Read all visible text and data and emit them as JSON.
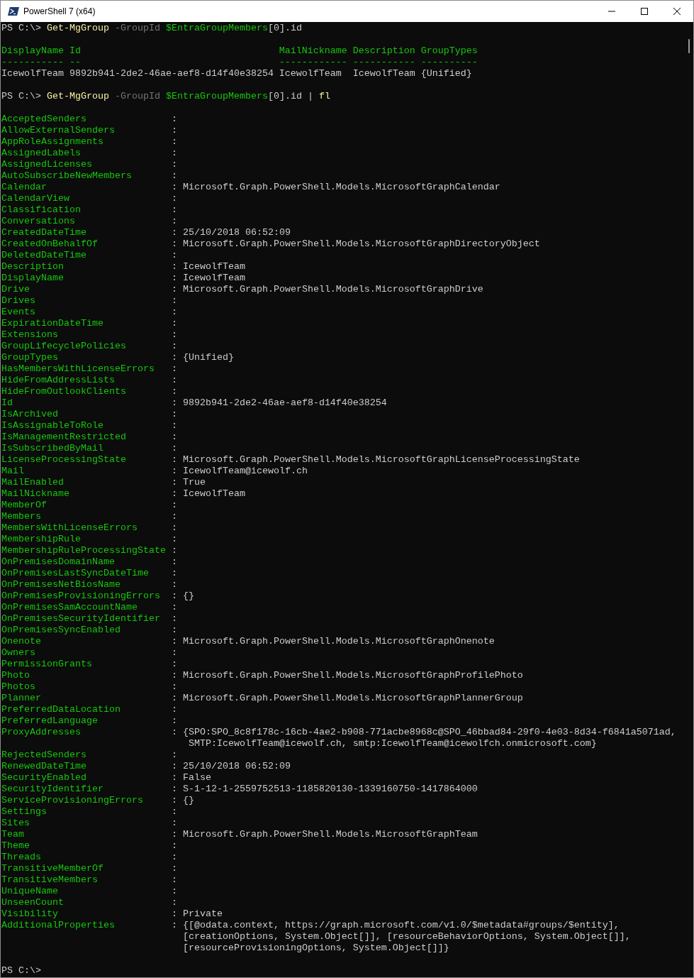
{
  "window": {
    "title": "PowerShell 7 (x64)"
  },
  "first_command": [
    {
      "kind": "prompt",
      "text": "PS C:\\> "
    },
    {
      "kind": "command",
      "text": "Get-MgGroup"
    },
    {
      "kind": "parameter",
      "text": " -GroupId "
    },
    {
      "kind": "variable",
      "text": "$EntraGroupMembers"
    },
    {
      "kind": "plain",
      "text": "[0].id"
    }
  ],
  "table": {
    "columns": [
      {
        "label": "DisplayName",
        "rule": "-----------"
      },
      {
        "label": "Id",
        "rule": "--"
      },
      {
        "label": "MailNickname",
        "rule": "------------"
      },
      {
        "label": "Description",
        "rule": "-----------"
      },
      {
        "label": "GroupTypes",
        "rule": "----------"
      }
    ],
    "rows": [
      [
        "IcewolfTeam",
        "9892b941-2de2-46ae-aef8-d14f40e38254",
        "IcewolfTeam",
        "IcewolfTeam",
        "{Unified}"
      ]
    ]
  },
  "second_command": [
    {
      "kind": "prompt",
      "text": "PS C:\\> "
    },
    {
      "kind": "command",
      "text": "Get-MgGroup"
    },
    {
      "kind": "parameter",
      "text": " -GroupId "
    },
    {
      "kind": "variable",
      "text": "$EntraGroupMembers"
    },
    {
      "kind": "plain",
      "text": "[0].id | "
    },
    {
      "kind": "command",
      "text": "fl"
    }
  ],
  "properties": [
    {
      "name": "AcceptedSenders",
      "sep": ":"
    },
    {
      "name": "AllowExternalSenders",
      "sep": ":"
    },
    {
      "name": "AppRoleAssignments",
      "sep": ":"
    },
    {
      "name": "AssignedLabels",
      "sep": ":"
    },
    {
      "name": "AssignedLicenses",
      "sep": ":"
    },
    {
      "name": "AutoSubscribeNewMembers",
      "sep": ":"
    },
    {
      "name": "Calendar",
      "sep": ":",
      "value": [
        "Microsoft.Graph.PowerShell.Models.MicrosoftGraphCalendar"
      ]
    },
    {
      "name": "CalendarView",
      "sep": ":"
    },
    {
      "name": "Classification",
      "sep": ":"
    },
    {
      "name": "Conversations",
      "sep": ":"
    },
    {
      "name": "CreatedDateTime",
      "sep": ":",
      "value": [
        "25/10/2018 06:52:09"
      ]
    },
    {
      "name": "CreatedOnBehalfOf",
      "sep": ":",
      "value": [
        "Microsoft.Graph.PowerShell.Models.MicrosoftGraphDirectoryObject"
      ]
    },
    {
      "name": "DeletedDateTime",
      "sep": ":"
    },
    {
      "name": "Description",
      "sep": ":",
      "value": [
        "IcewolfTeam"
      ]
    },
    {
      "name": "DisplayName",
      "sep": ":",
      "value": [
        "IcewolfTeam"
      ]
    },
    {
      "name": "Drive",
      "sep": ":",
      "value": [
        "Microsoft.Graph.PowerShell.Models.MicrosoftGraphDrive"
      ]
    },
    {
      "name": "Drives",
      "sep": ":"
    },
    {
      "name": "Events",
      "sep": ":"
    },
    {
      "name": "ExpirationDateTime",
      "sep": ":"
    },
    {
      "name": "Extensions",
      "sep": ":"
    },
    {
      "name": "GroupLifecyclePolicies",
      "sep": ":"
    },
    {
      "name": "GroupTypes",
      "sep": ":",
      "value": [
        "{Unified}"
      ]
    },
    {
      "name": "HasMembersWithLicenseErrors",
      "sep": ":"
    },
    {
      "name": "HideFromAddressLists",
      "sep": ":"
    },
    {
      "name": "HideFromOutlookClients",
      "sep": ":"
    },
    {
      "name": "Id",
      "sep": ":",
      "value": [
        "9892b941-2de2-46ae-aef8-d14f40e38254"
      ]
    },
    {
      "name": "IsArchived",
      "sep": ":"
    },
    {
      "name": "IsAssignableToRole",
      "sep": ":"
    },
    {
      "name": "IsManagementRestricted",
      "sep": ":"
    },
    {
      "name": "IsSubscribedByMail",
      "sep": ":"
    },
    {
      "name": "LicenseProcessingState",
      "sep": ":",
      "value": [
        "Microsoft.Graph.PowerShell.Models.MicrosoftGraphLicenseProcessingState"
      ]
    },
    {
      "name": "Mail",
      "sep": ":",
      "value": [
        "IcewolfTeam@icewolf.ch"
      ]
    },
    {
      "name": "MailEnabled",
      "sep": ":",
      "value": [
        "True"
      ]
    },
    {
      "name": "MailNickname",
      "sep": ":",
      "value": [
        "IcewolfTeam"
      ]
    },
    {
      "name": "MemberOf",
      "sep": ":"
    },
    {
      "name": "Members",
      "sep": ":"
    },
    {
      "name": "MembersWithLicenseErrors",
      "sep": ":"
    },
    {
      "name": "MembershipRule",
      "sep": ":"
    },
    {
      "name": "MembershipRuleProcessingState",
      "sep": ":"
    },
    {
      "name": "OnPremisesDomainName",
      "sep": ":"
    },
    {
      "name": "OnPremisesLastSyncDateTime",
      "sep": ":"
    },
    {
      "name": "OnPremisesNetBiosName",
      "sep": ":"
    },
    {
      "name": "OnPremisesProvisioningErrors",
      "sep": ":",
      "value": [
        "{}"
      ]
    },
    {
      "name": "OnPremisesSamAccountName",
      "sep": ":"
    },
    {
      "name": "OnPremisesSecurityIdentifier",
      "sep": ":"
    },
    {
      "name": "OnPremisesSyncEnabled",
      "sep": ":"
    },
    {
      "name": "Onenote",
      "sep": ":",
      "value": [
        "Microsoft.Graph.PowerShell.Models.MicrosoftGraphOnenote"
      ]
    },
    {
      "name": "Owners",
      "sep": ":"
    },
    {
      "name": "PermissionGrants",
      "sep": ":"
    },
    {
      "name": "Photo",
      "sep": ":",
      "value": [
        "Microsoft.Graph.PowerShell.Models.MicrosoftGraphProfilePhoto"
      ]
    },
    {
      "name": "Photos",
      "sep": ":"
    },
    {
      "name": "Planner",
      "sep": ":",
      "value": [
        "Microsoft.Graph.PowerShell.Models.MicrosoftGraphPlannerGroup"
      ]
    },
    {
      "name": "PreferredDataLocation",
      "sep": ":"
    },
    {
      "name": "PreferredLanguage",
      "sep": ":"
    },
    {
      "name": "ProxyAddresses",
      "sep": ":",
      "value": [
        "{SPO:SPO_8c8f178c-16cb-4ae2-b908-771acbe8968c@SPO_46bbad84-29f0-4e03-8d34-f6841a5071ad,",
        " SMTP:IcewolfTeam@icewolf.ch, smtp:IcewolfTeam@icewolfch.onmicrosoft.com}"
      ]
    },
    {
      "name": "RejectedSenders",
      "sep": ":"
    },
    {
      "name": "RenewedDateTime",
      "sep": ":",
      "value": [
        "25/10/2018 06:52:09"
      ]
    },
    {
      "name": "SecurityEnabled",
      "sep": ":",
      "value": [
        "False"
      ]
    },
    {
      "name": "SecurityIdentifier",
      "sep": ":",
      "value": [
        "S-1-12-1-2559752513-1185820130-1339160750-1417864000"
      ]
    },
    {
      "name": "ServiceProvisioningErrors",
      "sep": ":",
      "value": [
        "{}"
      ]
    },
    {
      "name": "Settings",
      "sep": ":"
    },
    {
      "name": "Sites",
      "sep": ":"
    },
    {
      "name": "Team",
      "sep": ":",
      "value": [
        "Microsoft.Graph.PowerShell.Models.MicrosoftGraphTeam"
      ]
    },
    {
      "name": "Theme",
      "sep": ":"
    },
    {
      "name": "Threads",
      "sep": ":"
    },
    {
      "name": "TransitiveMemberOf",
      "sep": ":"
    },
    {
      "name": "TransitiveMembers",
      "sep": ":"
    },
    {
      "name": "UniqueName",
      "sep": ":"
    },
    {
      "name": "UnseenCount",
      "sep": ":"
    },
    {
      "name": "Visibility",
      "sep": ":",
      "value": [
        "Private"
      ]
    },
    {
      "name": "AdditionalProperties",
      "sep": ":",
      "value": [
        "{[@odata.context, https://graph.microsoft.com/v1.0/$metadata#groups/$entity],",
        "[creationOptions, System.Object[]], [resourceBehaviorOptions, System.Object[]],",
        "[resourceProvisioningOptions, System.Object[]]}"
      ]
    }
  ],
  "final_prompt": "PS C:\\>"
}
